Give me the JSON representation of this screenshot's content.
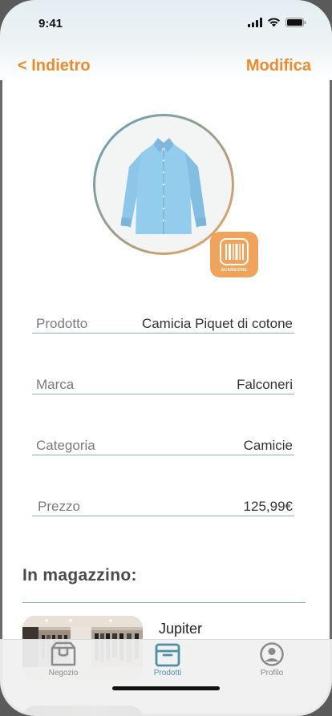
{
  "status": {
    "time": "9:41"
  },
  "nav": {
    "back_label": "< Indietro",
    "edit_label": "Modifica"
  },
  "scan": {
    "label": "SCANSIONE"
  },
  "fields": [
    {
      "label": "Prodotto",
      "value": "Camicia Piquet di cotone"
    },
    {
      "label": "Marca",
      "value": "Falconeri"
    },
    {
      "label": "Categoria",
      "value": "Camicie"
    },
    {
      "label": "Prezzo",
      "value": "125,99€"
    }
  ],
  "stock": {
    "title": "In magazzino:",
    "stores": [
      {
        "name": "Jupiter"
      }
    ]
  },
  "tabs": [
    {
      "label": "Negozio",
      "icon": "store-icon",
      "active": false
    },
    {
      "label": "Prodotti",
      "icon": "box-icon",
      "active": true
    },
    {
      "label": "Profilo",
      "icon": "profile-icon",
      "active": false
    }
  ],
  "colors": {
    "accent": "#ee8a2b",
    "teal": "#4f8fa6",
    "scan_bg": "#f0a35a",
    "divider": "#86b3c4"
  }
}
